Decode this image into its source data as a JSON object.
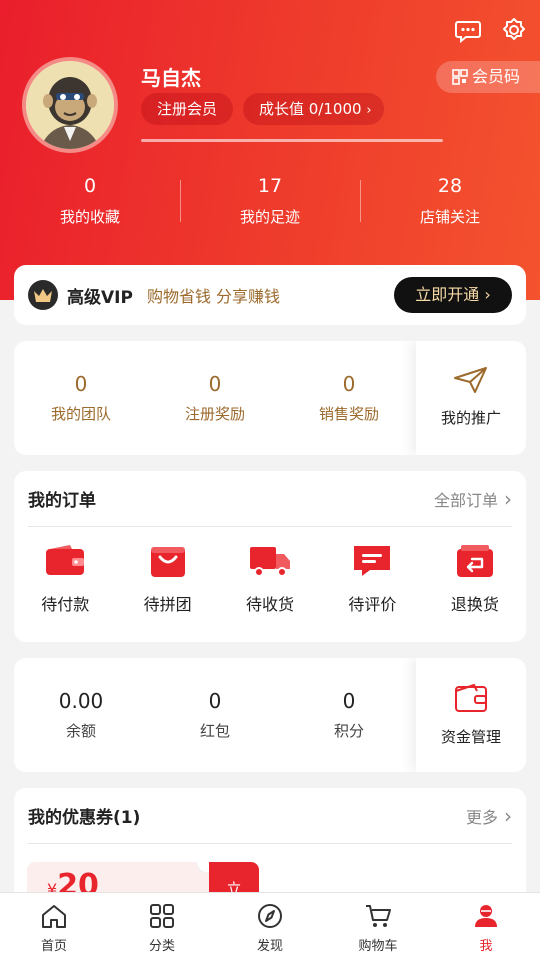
{
  "profile": {
    "name": "马自杰",
    "member_level": "注册会员",
    "growth": "成长值 0/1000",
    "member_code": "会员码",
    "progress_fraction": 0
  },
  "stats": [
    {
      "value": "0",
      "label": "我的收藏"
    },
    {
      "value": "17",
      "label": "我的足迹"
    },
    {
      "value": "28",
      "label": "店铺关注"
    }
  ],
  "vip": {
    "title": "高级VIP",
    "slogan": "购物省钱 分享赚钱",
    "button": "立即开通"
  },
  "promotion": {
    "items": [
      {
        "value": "0",
        "label": "我的团队"
      },
      {
        "value": "0",
        "label": "注册奖励"
      },
      {
        "value": "0",
        "label": "销售奖励"
      }
    ],
    "side_label": "我的推广"
  },
  "orders": {
    "title": "我的订单",
    "all_label": "全部订单",
    "items": [
      {
        "label": "待付款",
        "icon": "wallet-icon"
      },
      {
        "label": "待拼团",
        "icon": "shopping-bag-icon"
      },
      {
        "label": "待收货",
        "icon": "truck-icon"
      },
      {
        "label": "待评价",
        "icon": "comment-icon"
      },
      {
        "label": "退换货",
        "icon": "return-icon"
      }
    ]
  },
  "funds": {
    "items": [
      {
        "value": "0.00",
        "label": "余额"
      },
      {
        "value": "0",
        "label": "红包"
      },
      {
        "value": "0",
        "label": "积分"
      }
    ],
    "side_label": "资金管理"
  },
  "coupons": {
    "title": "我的优惠券(1)",
    "more_label": "更多",
    "items": [
      {
        "symbol": "¥",
        "amount": "20",
        "button": "立"
      }
    ]
  },
  "tabbar": [
    {
      "label": "首页",
      "icon": "home-icon"
    },
    {
      "label": "分类",
      "icon": "category-icon"
    },
    {
      "label": "发现",
      "icon": "compass-icon"
    },
    {
      "label": "购物车",
      "icon": "cart-icon"
    },
    {
      "label": "我",
      "icon": "user-icon",
      "active": true
    }
  ],
  "colors": {
    "primary": "#e8242c",
    "gold": "#9c6a2c"
  }
}
